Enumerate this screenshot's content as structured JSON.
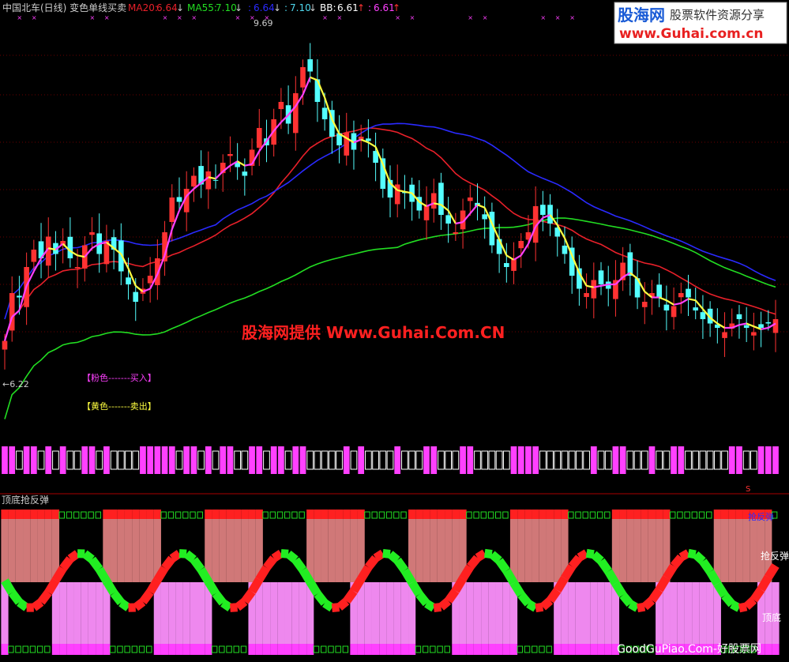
{
  "header": {
    "title": "中国北车(日线) 变色单线买卖",
    "ma20_label": "MA20:",
    "ma20_value": "6.64",
    "ma55_label": "MA55:",
    "ma55_value": "7.10",
    "value3": "6.64",
    "value4": "7.10",
    "bb_label": "BB:",
    "bb_value": "6.61",
    "value6": "6.61",
    "arrow_down": "↓",
    "arrow_up": "↑",
    "separator": ":"
  },
  "watermark": {
    "logo_text": "股海网",
    "logo_sub": "股票软件资源分享",
    "logo_url": "www.Guhai.com.cn",
    "center": "股海网提供 Www.Guhai.Com.CN",
    "bottom": "GoodGuPiao.Com-好股票网"
  },
  "annotations": {
    "high_label": "9.69",
    "low_label": "←6.22",
    "legend_pink": "【粉色-------买入】",
    "legend_yellow": "【黄色-------卖出】",
    "signal_mark": "S"
  },
  "sub_panel": {
    "title": "顶底抢反弹",
    "label_top": "抢反弹",
    "label_right": "抢反弹",
    "label_bottom": "顶底"
  },
  "colors": {
    "up": "#ff3232",
    "down": "#54ffff",
    "ma20": "#e8202a",
    "ma55": "#22dd22",
    "ma_blue": "#2a2aff",
    "ma_cyan": "#4fd8ee",
    "signal_buy": "#ff40ff",
    "signal_sell": "#ffff40",
    "accent_magenta": "#ff40ff"
  },
  "chart_data": {
    "type": "candlestick",
    "title": "中国北车(日线)",
    "indicator": "变色单线买卖",
    "ylim": [
      6.0,
      10.0
    ],
    "high": 9.69,
    "low": 6.22,
    "close": [
      6.35,
      6.9,
      6.85,
      7.2,
      7.4,
      7.3,
      7.55,
      7.35,
      7.5,
      7.3,
      7.2,
      7.45,
      7.6,
      7.35,
      7.5,
      7.4,
      7.15,
      7.0,
      6.8,
      6.95,
      7.1,
      7.3,
      7.6,
      8.0,
      7.95,
      8.1,
      8.25,
      8.15,
      8.3,
      8.2,
      8.4,
      8.5,
      8.35,
      8.25,
      8.55,
      8.8,
      8.6,
      8.9,
      9.1,
      8.85,
      9.2,
      9.5,
      9.45,
      9.1,
      8.9,
      8.7,
      8.6,
      8.75,
      8.55,
      8.7,
      8.65,
      8.4,
      8.1,
      8.0,
      8.15,
      8.05,
      7.95,
      7.85,
      7.9,
      8.05,
      7.8,
      7.7,
      7.6,
      7.85,
      8.0,
      7.9,
      7.75,
      7.45,
      7.35,
      7.2,
      7.3,
      7.5,
      7.6,
      7.9,
      7.8,
      7.7,
      7.55,
      7.35,
      7.1,
      6.95,
      6.9,
      7.05,
      7.0,
      6.95,
      7.05,
      7.25,
      7.1,
      6.85,
      6.8,
      6.9,
      6.85,
      6.7,
      6.75,
      6.9,
      6.85,
      6.7,
      6.6,
      6.55,
      6.5,
      6.45,
      6.55,
      6.6,
      6.5,
      6.45,
      6.5,
      6.55,
      6.6
    ]
  }
}
